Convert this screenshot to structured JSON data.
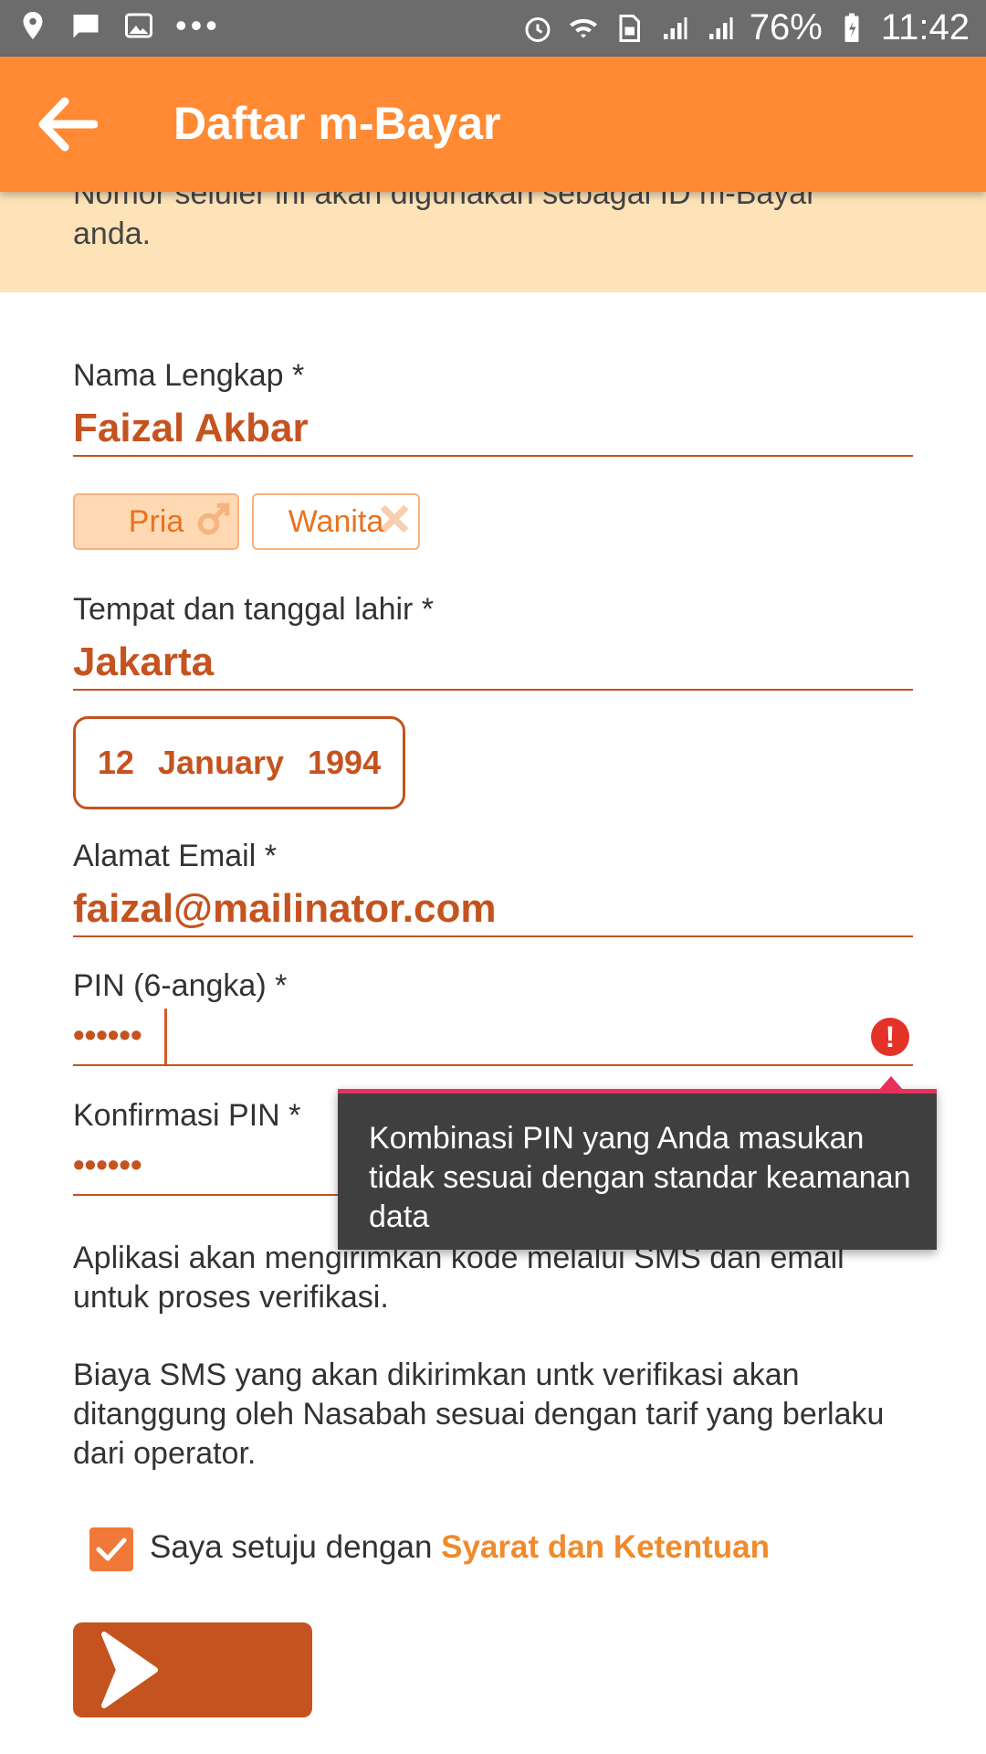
{
  "status_bar": {
    "battery": "76%",
    "time": "11:42",
    "icons_left": [
      "location-icon",
      "message-icon",
      "image-icon",
      "more-icon"
    ],
    "icons_right": [
      "alarm-icon",
      "wifi-icon",
      "sim-icon",
      "signal-icon",
      "signal-icon",
      "battery-icon"
    ]
  },
  "app_bar": {
    "title": "Daftar m-Bayar",
    "back_icon": "back-arrow-icon"
  },
  "banner": {
    "text": "Nomor seluler ini akan digunakan sebagai ID m-Bayar anda."
  },
  "form": {
    "full_name": {
      "label": "Nama Lengkap *",
      "value": "Faizal Akbar"
    },
    "gender": {
      "options": [
        "Pria",
        "Wanita"
      ],
      "selected": "Pria"
    },
    "birth": {
      "label": "Tempat dan tanggal lahir *",
      "place": "Jakarta",
      "day": "12",
      "month": "January",
      "year": "1994"
    },
    "email": {
      "label": "Alamat Email *",
      "value": "faizal@mailinator.com"
    },
    "pin": {
      "label": "PIN (6-angka) *",
      "value": "••••••"
    },
    "pin_confirm": {
      "label": "Konfirmasi PIN *",
      "value": "••••••"
    }
  },
  "tooltip": {
    "text": "Kombinasi PIN yang Anda masukan tidak sesuai dengan standar keamanan data"
  },
  "info": {
    "sms_notice": "Aplikasi akan mengirimkan kode melalui SMS dan email untuk proses verifikasi.",
    "cost_notice": "Biaya SMS yang akan dikirimkan untk verifikasi akan ditanggung oleh Nasabah sesuai dengan tarif yang berlaku dari operator."
  },
  "agreement": {
    "checked": true,
    "text": "Saya setuju dengan ",
    "link": "Syarat dan Ketentuan"
  },
  "colors": {
    "primary": "#ff8a33",
    "accent": "#c4531f",
    "banner": "#ffe3b8",
    "error": "#e53228",
    "tooltip_bg": "#3f3f3f"
  }
}
